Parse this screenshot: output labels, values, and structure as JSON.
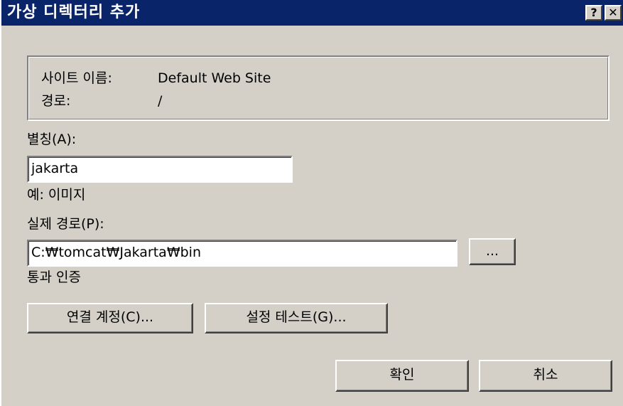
{
  "window": {
    "title": "가상 디렉터리 추가",
    "help_label": "?",
    "close_label": "✕"
  },
  "info": {
    "site_label": "사이트 이름:",
    "site_value": "Default Web Site",
    "path_label": "경로:",
    "path_value": "/"
  },
  "alias": {
    "label": "별칭(A):",
    "value": "jakarta",
    "example": "예: 이미지"
  },
  "physical_path": {
    "label": "실제 경로(P):",
    "value": "C:₩tomcat₩Jakarta₩bin",
    "browse_label": "..."
  },
  "auth": {
    "label": "통과 인증",
    "connect_as_label": "연결 계정(C)...",
    "test_settings_label": "설정 테스트(G)..."
  },
  "actions": {
    "ok_label": "확인",
    "cancel_label": "취소"
  }
}
